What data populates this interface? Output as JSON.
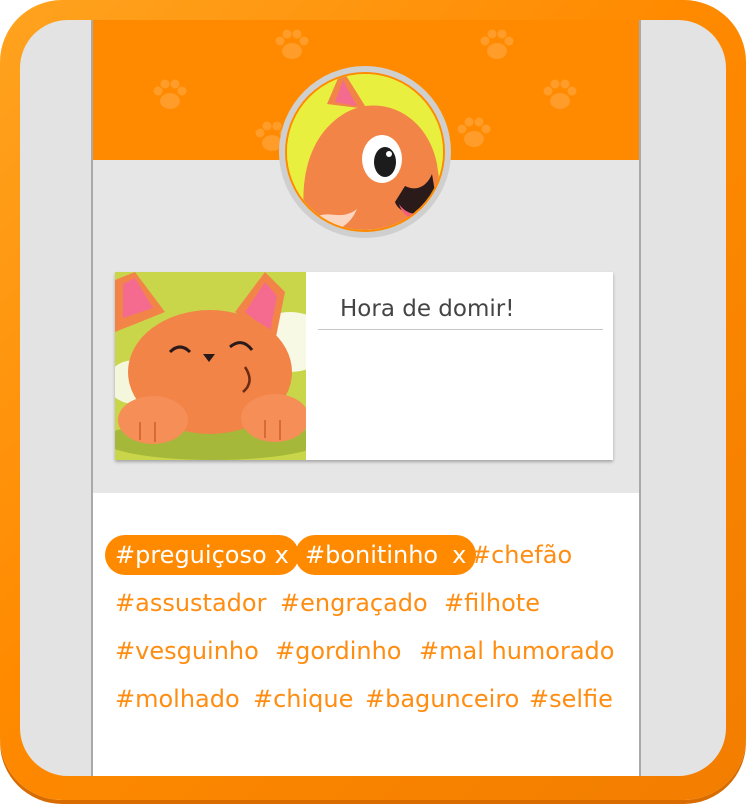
{
  "post": {
    "caption": "Hora de domir!"
  },
  "tags": {
    "selected": [
      {
        "label": "#preguiçoso",
        "remove": "x"
      },
      {
        "label": "#bonitinho",
        "remove": "x"
      }
    ],
    "suggestions": [
      "#chefão",
      "#assustador",
      "#engraçado",
      "#filhote",
      "#vesguinho",
      "#gordinho",
      "#mal humorado",
      "#molhado",
      "#chique",
      "#bagunceiro",
      "#selfie"
    ]
  },
  "colors": {
    "accent": "#ff8a00",
    "tag_text": "#ff8d12",
    "panel_bg": "#e6e6e6"
  },
  "icons": {
    "header_pattern": "paw-print-icon",
    "avatar": "fox-avatar",
    "post_image": "sleepy-fox-image"
  }
}
